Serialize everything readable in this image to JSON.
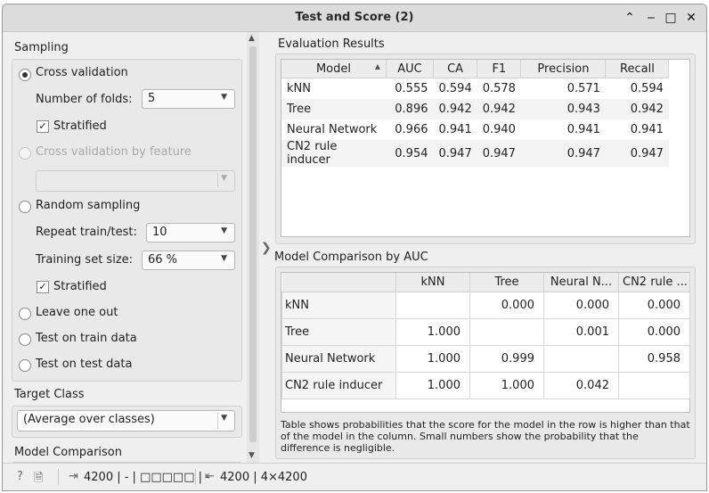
{
  "window": {
    "title": "Test and Score (2)",
    "controls": {
      "minimize": "‒",
      "collapse": "⌃",
      "maximize": "□",
      "close": "✕"
    }
  },
  "sampling": {
    "title": "Sampling",
    "cross_validation": "Cross validation",
    "folds_label": "Number of folds:",
    "folds_value": "5",
    "stratified_1": "Stratified",
    "cv_by_feature": "Cross validation by feature",
    "random_sampling": "Random sampling",
    "repeat_label": "Repeat train/test:",
    "repeat_value": "10",
    "training_size_label": "Training set size:",
    "training_size_value": "66 %",
    "stratified_2": "Stratified",
    "leave_one_out": "Leave one out",
    "test_on_train": "Test on train data",
    "test_on_test": "Test on test data"
  },
  "target": {
    "title": "Target Class",
    "value": "(Average over classes)"
  },
  "model_comparison_title": "Model Comparison",
  "evaluation": {
    "title": "Evaluation Results",
    "columns": [
      "Model",
      "AUC",
      "CA",
      "F1",
      "Precision",
      "Recall"
    ],
    "rows": [
      [
        "kNN",
        "0.555",
        "0.594",
        "0.578",
        "0.571",
        "0.594"
      ],
      [
        "Tree",
        "0.896",
        "0.942",
        "0.942",
        "0.943",
        "0.942"
      ],
      [
        "Neural Network",
        "0.966",
        "0.941",
        "0.940",
        "0.941",
        "0.941"
      ],
      [
        "CN2 rule inducer",
        "0.954",
        "0.947",
        "0.947",
        "0.947",
        "0.947"
      ]
    ]
  },
  "comparison": {
    "title": "Model Comparison by AUC",
    "columns": [
      "",
      "kNN",
      "Tree",
      "Neural N...",
      "CN2 rule ..."
    ],
    "rows": [
      [
        "kNN",
        "",
        "0.000",
        "0.000",
        "0.000"
      ],
      [
        "Tree",
        "1.000",
        "",
        "0.001",
        "0.000"
      ],
      [
        "Neural Network",
        "1.000",
        "0.999",
        "",
        "0.958"
      ],
      [
        "CN2 rule inducer",
        "1.000",
        "1.000",
        "0.042",
        ""
      ]
    ],
    "note": "Table shows probabilities that the score for the model in the row is higher than that of the model in the column. Small numbers show the probability that the difference is negligible."
  },
  "statusbar": {
    "input": "4200 | - | □□□□□ | -",
    "output": "4200 | 4×4200"
  }
}
